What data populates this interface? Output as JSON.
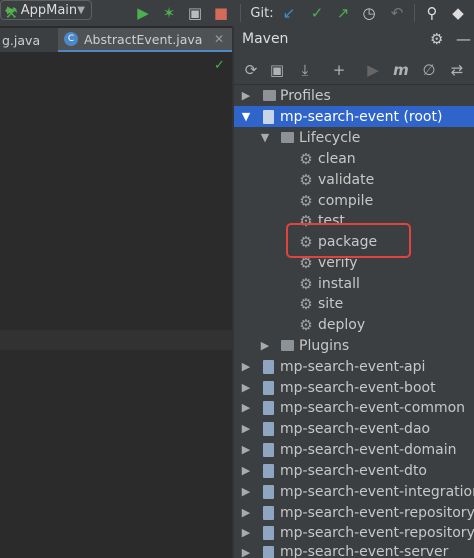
{
  "toolbar": {
    "run_config": "AppMain",
    "git_label": "Git:"
  },
  "editor": {
    "tabs": [
      {
        "label": "g.java"
      },
      {
        "label": "AbstractEvent.java"
      }
    ]
  },
  "maven": {
    "title": "Maven",
    "root": "mp-search-event (root)",
    "profiles": "Profiles",
    "lifecycle": "Lifecycle",
    "lifecycle_phases": [
      "clean",
      "validate",
      "compile",
      "test",
      "package",
      "verify",
      "install",
      "site",
      "deploy"
    ],
    "plugins": "Plugins",
    "modules": [
      "mp-search-event-api",
      "mp-search-event-boot",
      "mp-search-event-common",
      "mp-search-event-dao",
      "mp-search-event-domain",
      "mp-search-event-dto",
      "mp-search-event-integration",
      "mp-search-event-repository",
      "mp-search-event-repository-",
      "mp-search-event-server"
    ]
  },
  "colors": {
    "selection": "#2f65ca",
    "highlight_box": "#e0443e",
    "run_green": "#4caf50",
    "git_blue": "#3d8fd6"
  }
}
